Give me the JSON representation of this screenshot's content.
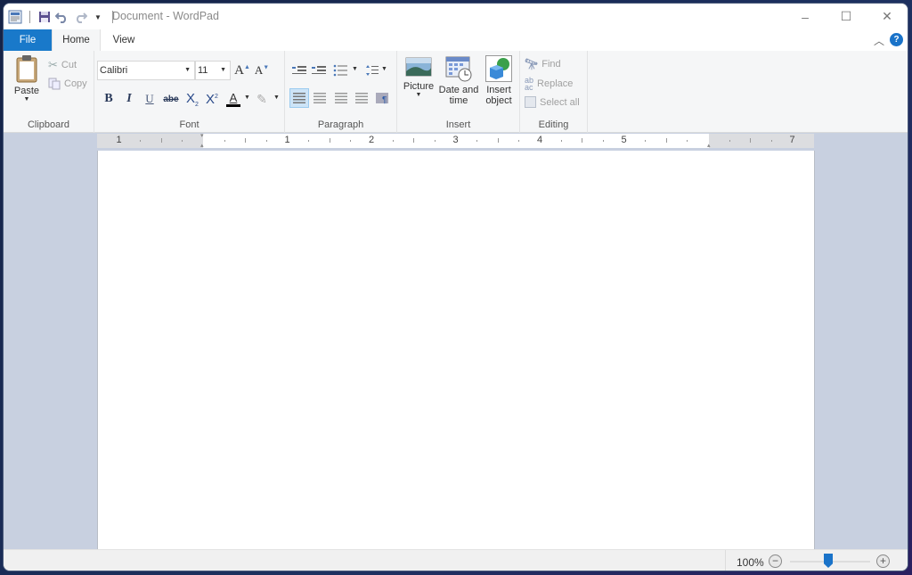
{
  "window": {
    "title": "Document - WordPad",
    "controls": {
      "minimize": "–",
      "maximize": "☐",
      "close": "✕"
    }
  },
  "quick_access": {
    "icons": [
      "wordpad-app-icon",
      "save-icon",
      "undo-icon",
      "redo-icon",
      "customize-dropdown-icon"
    ]
  },
  "tabs": [
    {
      "label": "File",
      "active": false
    },
    {
      "label": "Home",
      "active": true
    },
    {
      "label": "View",
      "active": false
    }
  ],
  "ribbon": {
    "clipboard": {
      "label": "Clipboard",
      "paste": "Paste",
      "cut": "Cut",
      "copy": "Copy"
    },
    "font": {
      "label": "Font",
      "family": "Calibri",
      "size": "11",
      "buttons": [
        "B",
        "I",
        "U",
        "abe"
      ]
    },
    "paragraph": {
      "label": "Paragraph"
    },
    "insert": {
      "label": "Insert",
      "picture": "Picture",
      "datetime_line1": "Date and",
      "datetime_line2": "time",
      "object_line1": "Insert",
      "object_line2": "object"
    },
    "editing": {
      "label": "Editing",
      "find": "Find",
      "replace": "Replace",
      "select_all": "Select all"
    }
  },
  "ruler": {
    "labels": [
      "1",
      "1",
      "2",
      "3",
      "4",
      "5",
      "7"
    ]
  },
  "status": {
    "zoom": "100%",
    "zoom_level": 100
  },
  "colors": {
    "accent": "#1979ca",
    "canvas": "#c8d0e0"
  }
}
